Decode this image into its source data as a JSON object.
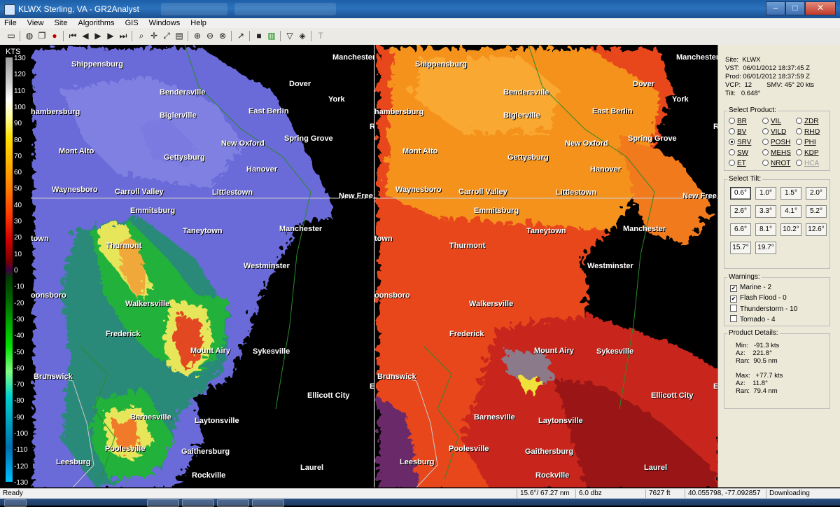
{
  "window": {
    "title": "KLWX Sterling, VA - GR2Analyst"
  },
  "menu": [
    "File",
    "View",
    "Site",
    "Algorithms",
    "GIS",
    "Windows",
    "Help"
  ],
  "colorbar": {
    "unit": "KTS",
    "ticks": [
      "130",
      "120",
      "110",
      "100",
      "90",
      "80",
      "70",
      "60",
      "50",
      "40",
      "30",
      "20",
      "10",
      "0",
      "-10",
      "-20",
      "-30",
      "-40",
      "-50",
      "-60",
      "-70",
      "-80",
      "-90",
      "-100",
      "-110",
      "-120",
      "-130"
    ]
  },
  "map": {
    "cities": [
      "Shippensburg",
      "Manchester",
      "Bendersville",
      "Dover",
      "York",
      "hambersburg",
      "Biglerville",
      "East Berlin",
      "R",
      "Mont Alto",
      "New Oxford",
      "Spring Grove",
      "Gettysburg",
      "Hanover",
      "Waynesboro",
      "Carroll Valley",
      "Littlestown",
      "New Free",
      "Emmitsburg",
      "Taneytown",
      "Manchester",
      "town",
      "Thurmont",
      "Westminster",
      "oonsboro",
      "Walkersville",
      "Frederick",
      "Mount Airy",
      "Sykesville",
      "Brunswick",
      "E",
      "Ellicott City",
      "Barnesville",
      "Laytonsville",
      "Poolesville",
      "Gaithersburg",
      "Leesburg",
      "Laurel",
      "Rockville"
    ]
  },
  "site": {
    "site_label": "Site:",
    "site": "KLWX",
    "vst_label": "VST:",
    "vst": "06/01/2012  18:37:45 Z",
    "prod_label": "Prod:",
    "prod": "06/01/2012  18:37:59 Z",
    "vcp_label": "VCP:",
    "vcp": "12",
    "smv": "SMV: 45° 20 kts",
    "tilt_label": "Tilt:",
    "tilt": "0.648°"
  },
  "select_product": {
    "title": "Select Product:",
    "options": [
      {
        "label": "BR",
        "selected": false,
        "enabled": true
      },
      {
        "label": "VIL",
        "selected": false,
        "enabled": true
      },
      {
        "label": "ZDR",
        "selected": false,
        "enabled": true
      },
      {
        "label": "BV",
        "selected": false,
        "enabled": true
      },
      {
        "label": "VILD",
        "selected": false,
        "enabled": true
      },
      {
        "label": "RHO",
        "selected": false,
        "enabled": true
      },
      {
        "label": "SRV",
        "selected": true,
        "enabled": true
      },
      {
        "label": "POSH",
        "selected": false,
        "enabled": true
      },
      {
        "label": "PHI",
        "selected": false,
        "enabled": true
      },
      {
        "label": "SW",
        "selected": false,
        "enabled": true
      },
      {
        "label": "MEHS",
        "selected": false,
        "enabled": true
      },
      {
        "label": "KDP",
        "selected": false,
        "enabled": true
      },
      {
        "label": "ET",
        "selected": false,
        "enabled": true
      },
      {
        "label": "NROT",
        "selected": false,
        "enabled": true
      },
      {
        "label": "HCA",
        "selected": false,
        "enabled": false
      }
    ]
  },
  "select_tilt": {
    "title": "Select Tilt:",
    "tilts": [
      "0.6°",
      "1.0°",
      "1.5°",
      "2.0°",
      "2.6°",
      "3.3°",
      "4.1°",
      "5.2°",
      "6.6°",
      "8.1°",
      "10.2°",
      "12.6°",
      "15.7°",
      "19.7°"
    ],
    "selected": "0.6°"
  },
  "warnings": {
    "title": "Warnings:",
    "items": [
      {
        "label": "Marine - 2",
        "checked": true
      },
      {
        "label": "Flash Flood - 0",
        "checked": true
      },
      {
        "label": "Thunderstorm - 10",
        "checked": false
      },
      {
        "label": "Tornado - 4",
        "checked": false
      }
    ]
  },
  "details": {
    "title": "Product Details:",
    "min_label": "Min:",
    "min": "-91.3 kts",
    "min_az_label": "Az:",
    "min_az": "221.8°",
    "min_ran_label": "Ran:",
    "min_ran": "90.5 nm",
    "max_label": "Max:",
    "max": "+77.7 kts",
    "max_az_label": "Az:",
    "max_az": "11.8°",
    "max_ran_label": "Ran:",
    "max_ran": "79.4 nm"
  },
  "status": {
    "ready": "Ready",
    "azimuth_range": "15.6°/ 67.27 nm",
    "dbz": "6.0 dbz",
    "height": "7627 ft",
    "coords": "40.055798, -77.092857",
    "state": "Downloading"
  },
  "colors": {
    "title_bar": "#2b72bd",
    "panel_bg": "#ece9d8",
    "map_bg": "#000000"
  }
}
